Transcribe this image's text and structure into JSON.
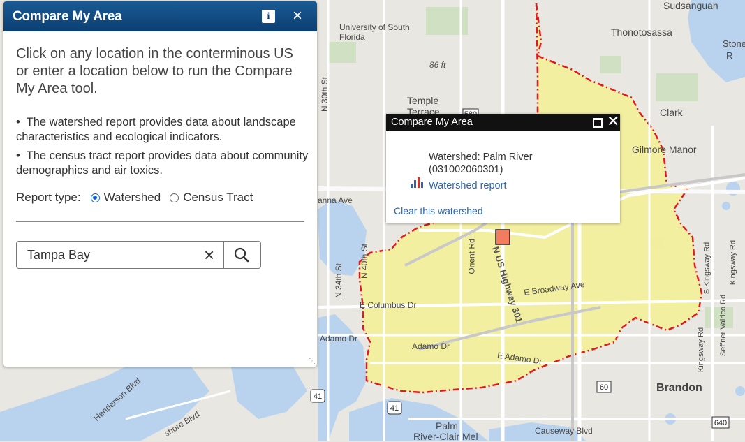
{
  "panel": {
    "title": "Compare My Area",
    "info_icon": "i",
    "close_icon": "×",
    "intro": "Click on any location in the conterminous US or enter a location below to run the Compare My Area tool.",
    "bullets": [
      "The watershed report provides data about landscape characteristics and ecological indicators.",
      "The census tract report provides data about community demographics and air toxics."
    ],
    "report_type_label": "Report type:",
    "report_options": [
      "Watershed",
      "Census Tract"
    ],
    "selected_report": "Watershed",
    "search": {
      "value": "Tampa Bay",
      "clear_icon": "×"
    }
  },
  "popup": {
    "title": "Compare My Area",
    "watershed_name": "Watershed: Palm River (031002060301)",
    "report_link": "Watershed report",
    "clear_link": "Clear this watershed"
  },
  "map_labels": {
    "sudsanguan": "Sudsanguan",
    "usf": "University of South Florida",
    "thonotosassa": "Thonotosassa",
    "stone": "Stone",
    "r": "R",
    "elev": "86 ft",
    "n30": "N 30th St",
    "temple": "Temple Terrace",
    "clark": "Clark",
    "gilmore": "Gilmore Manor",
    "anna": "anna Ave",
    "n40": "N 40th St",
    "n34": "N 34th St",
    "orient": "Orient Rd",
    "us301": "N US Highway 301",
    "broadway": "E Broadway Ave",
    "columbus": "E Columbus Dr",
    "adamo_w": "Adamo Dr",
    "adamo_c": "Adamo Dr",
    "adamo_e": "E Adamo Dr",
    "henderson": "Henderson Blvd",
    "bayshore": "shore Blvd",
    "palm": "Palm",
    "palm_clair": "River-Clair Mel",
    "causeway": "Causeway Blvd",
    "brandon": "Brandon",
    "kingsway_s": "S Kingsway Rd",
    "kingsway": "Kingsway Rd",
    "seffner": "Seffner Valrico Rd",
    "kingsway_rd": "Kingsway Rd",
    "hw41": "41",
    "hw41b": "41",
    "hw60": "60",
    "hw640": "640",
    "hw580": "580"
  },
  "colors": {
    "header": "#0b3f72",
    "watershed_fill": "#f4f09a",
    "watershed_border": "#e0191c",
    "water": "#b9d3ee",
    "link": "#2d65a8"
  }
}
